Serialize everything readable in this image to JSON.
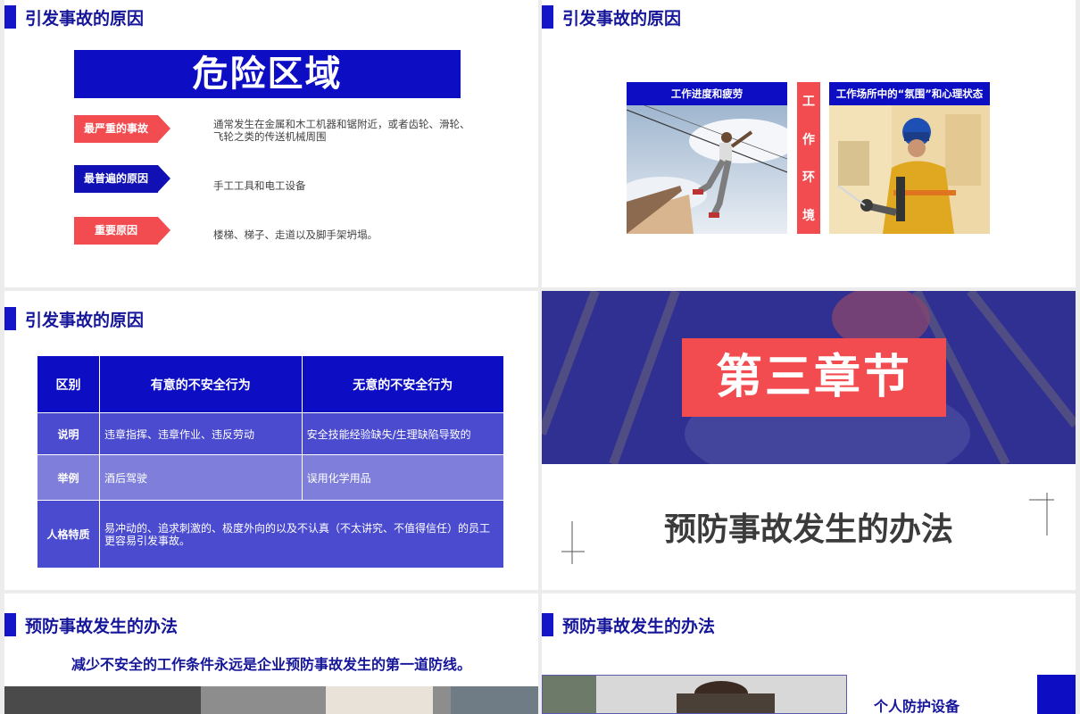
{
  "slides": {
    "s1": {
      "title": "引发事故的原因",
      "banner": "危险区域",
      "rows": [
        {
          "tag": "最严重的事故",
          "desc": "通常发生在金属和木工机器和锯附近，或者齿轮、滑轮、飞轮之类的传送机械周围"
        },
        {
          "tag": "最普遍的原因",
          "desc": "手工工具和电工设备"
        },
        {
          "tag": "重要原因",
          "desc": "楼梯、梯子、走道以及脚手架坍塌。"
        }
      ]
    },
    "s2": {
      "title": "引发事故的原因",
      "left_caption": "工作进度和疲劳",
      "right_caption": "工作场所中的“氛围”和心理状态",
      "vertical": [
        "工",
        "作",
        "环",
        "境"
      ]
    },
    "s3": {
      "title": "引发事故的原因",
      "headers": [
        "区别",
        "有意的不安全行为",
        "无意的不安全行为"
      ],
      "rows": [
        {
          "key": "说明",
          "a": "违章指挥、违章作业、违反劳动",
          "b": "安全技能经验缺失/生理缺陷导致的"
        },
        {
          "key": "举例",
          "a": "酒后驾驶",
          "b": "误用化学用品"
        },
        {
          "key": "人格特质",
          "a": "易冲动的、追求刺激的、极度外向的以及不认真（不太讲究、不值得信任）的员工更容易引发事故。"
        }
      ]
    },
    "s4": {
      "chapter": "第三章节",
      "title": "预防事故发生的办法"
    },
    "s5": {
      "title": "预防事故发生的办法",
      "subtitle": "减少不安全的工作条件永远是企业预防事故发生的第一道防线。"
    },
    "s6": {
      "title": "预防事故发生的办法",
      "item": "个人防护设备"
    }
  },
  "colors": {
    "primary": "#0d0dc4",
    "accent": "#f24c50",
    "heading": "#16169a"
  }
}
